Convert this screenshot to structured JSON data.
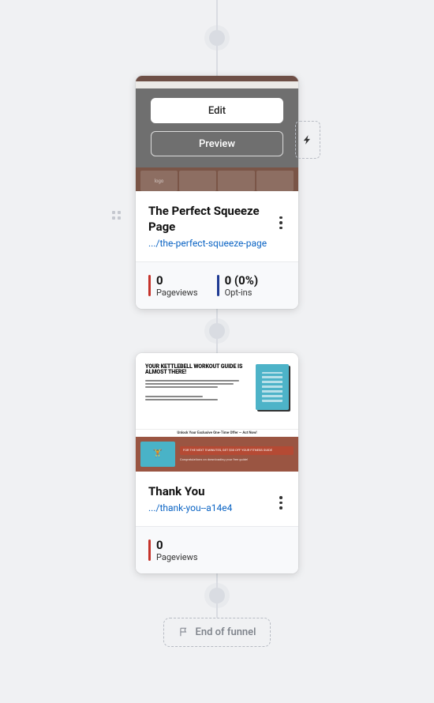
{
  "overlay": {
    "edit_label": "Edit",
    "preview_label": "Preview"
  },
  "card1": {
    "title": "The Perfect Squeeze Page",
    "url": ".../the-perfect-squeeze-page",
    "tab_labels": [
      "logo",
      "",
      "",
      ""
    ],
    "stats": [
      {
        "value": "0",
        "label": "Pageviews",
        "accent": "red"
      },
      {
        "value": "0 (0%)",
        "label": "Opt-ins",
        "accent": "blue"
      }
    ]
  },
  "card2": {
    "title": "Thank You",
    "url": ".../thank-you--a14e4",
    "preview": {
      "headline": "YOUR KETTLEBELL WORKOUT GUIDE IS ALMOST THERE!",
      "banner": "Unlock Your Exclusive One-Time Offer — Act Now!",
      "promo_badge": "FOR THE NEXT 5 MINUTES, GET $30 OFF YOUR FITNESS GUIDE",
      "promo_sub": "Congratulations on downloading your free guide!"
    },
    "stats": [
      {
        "value": "0",
        "label": "Pageviews",
        "accent": "red"
      }
    ]
  },
  "end": {
    "label": "End of funnel"
  },
  "icons": {
    "kebab": "more-options",
    "drag": "drag-handle",
    "bolt": "automation",
    "flag": "flag"
  }
}
